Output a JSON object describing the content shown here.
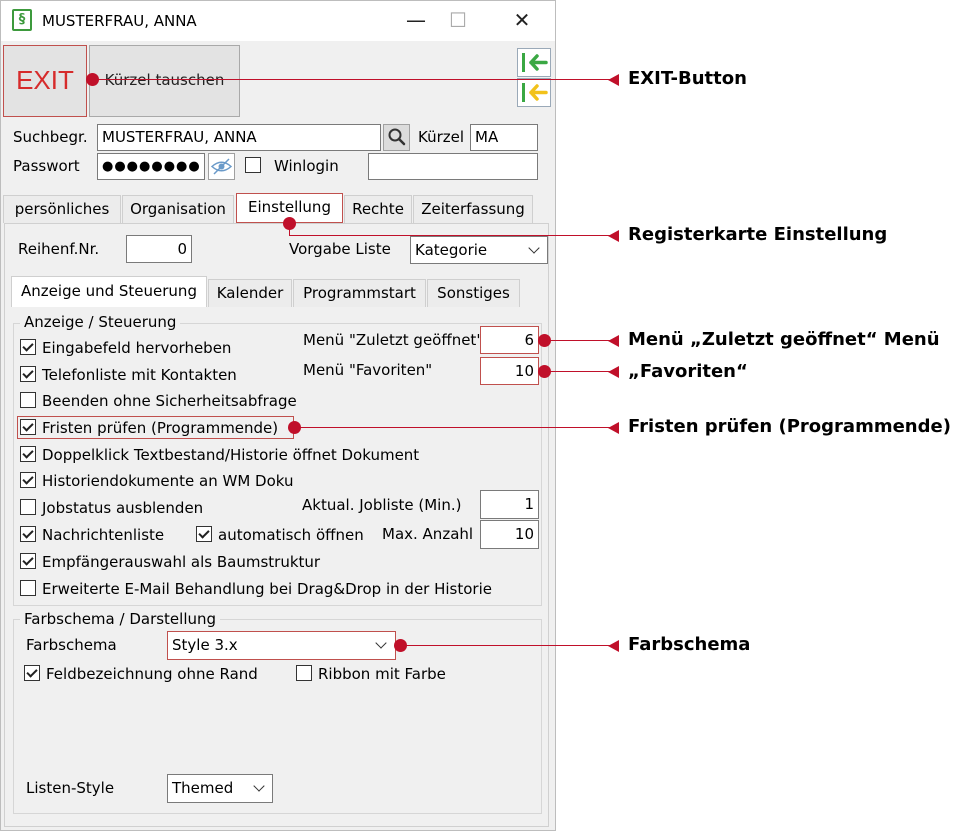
{
  "window": {
    "title": "MUSTERFRAU, ANNA",
    "app_icon_glyph": "§",
    "minimize_glyph": "—",
    "maximize_glyph": "☐",
    "close_glyph": "✕"
  },
  "toolbar": {
    "exit_label": "EXIT",
    "swap_label": "Kürzel tauschen"
  },
  "header": {
    "search_label": "Suchbegr.",
    "search_value": "MUSTERFRAU, ANNA",
    "kuerzel_label": "Kürzel",
    "kuerzel_value": "MA",
    "password_label": "Passwort",
    "password_value": "●●●●●●●●",
    "winlogin_label": "Winlogin",
    "winlogin_checked": false
  },
  "main_tabs": [
    {
      "label": "persönliches",
      "selected": false
    },
    {
      "label": "Organisation",
      "selected": false
    },
    {
      "label": "Einstellung",
      "selected": true
    },
    {
      "label": "Rechte",
      "selected": false
    },
    {
      "label": "Zeiterfassung",
      "selected": false
    }
  ],
  "einstellung": {
    "reihenf_label": "Reihenf.Nr.",
    "reihenf_value": "0",
    "vorgabe_label": "Vorgabe Liste",
    "vorgabe_value": "Kategorie"
  },
  "sub_tabs": [
    {
      "label": "Anzeige und Steuerung",
      "selected": true
    },
    {
      "label": "Kalender",
      "selected": false
    },
    {
      "label": "Programmstart",
      "selected": false
    },
    {
      "label": "Sonstiges",
      "selected": false
    }
  ],
  "anzeige": {
    "group_title": "Anzeige / Steuerung",
    "zuletzt_label": "Menü \"Zuletzt geöffnet\"",
    "zuletzt_value": "6",
    "favoriten_label": "Menü \"Favoriten\"",
    "favoriten_value": "10",
    "jobliste_label": "Aktual. Jobliste (Min.)",
    "jobliste_value": "1",
    "max_label": "Max. Anzahl",
    "max_value": "10",
    "checkboxes": [
      {
        "label": "Eingabefeld hervorheben",
        "checked": true
      },
      {
        "label": "Telefonliste mit Kontakten",
        "checked": true
      },
      {
        "label": "Beenden ohne Sicherheitsabfrage",
        "checked": false
      },
      {
        "label": "Fristen prüfen (Programmende)",
        "checked": true
      },
      {
        "label": "Doppelklick Textbestand/Historie öffnet Dokument",
        "checked": true
      },
      {
        "label": "Historiendokumente an WM Doku",
        "checked": true
      },
      {
        "label": "Jobstatus ausblenden",
        "checked": false
      },
      {
        "label": "Nachrichtenliste",
        "checked": true
      },
      {
        "label": "automatisch öffnen",
        "checked": true
      },
      {
        "label": "Empfängerauswahl als Baumstruktur",
        "checked": true
      },
      {
        "label": "Erweiterte E-Mail Behandlung bei Drag&Drop in der Historie",
        "checked": false
      }
    ]
  },
  "farbschema": {
    "group_title": "Farbschema / Darstellung",
    "label": "Farbschema",
    "value": "Style 3.x",
    "feld_label": "Feldbezeichnung ohne Rand",
    "feld_checked": true,
    "ribbon_label": "Ribbon mit Farbe",
    "ribbon_checked": false,
    "listen_label": "Listen-Style",
    "listen_value": "Themed"
  },
  "callouts": {
    "exit": "EXIT-Button",
    "register": "Registerkarte Einstellung",
    "zuletzt": "Menü „Zuletzt geöffnet“ Menü",
    "favoriten": "„Favoriten“",
    "fristen": "Fristen prüfen (Programmende)",
    "farbschema": "Farbschema"
  },
  "colors": {
    "callout_red": "#c0102a",
    "exit_red": "#d62b2b",
    "arrow_green": "#3aa843",
    "arrow_yellow": "#f2c21b"
  }
}
